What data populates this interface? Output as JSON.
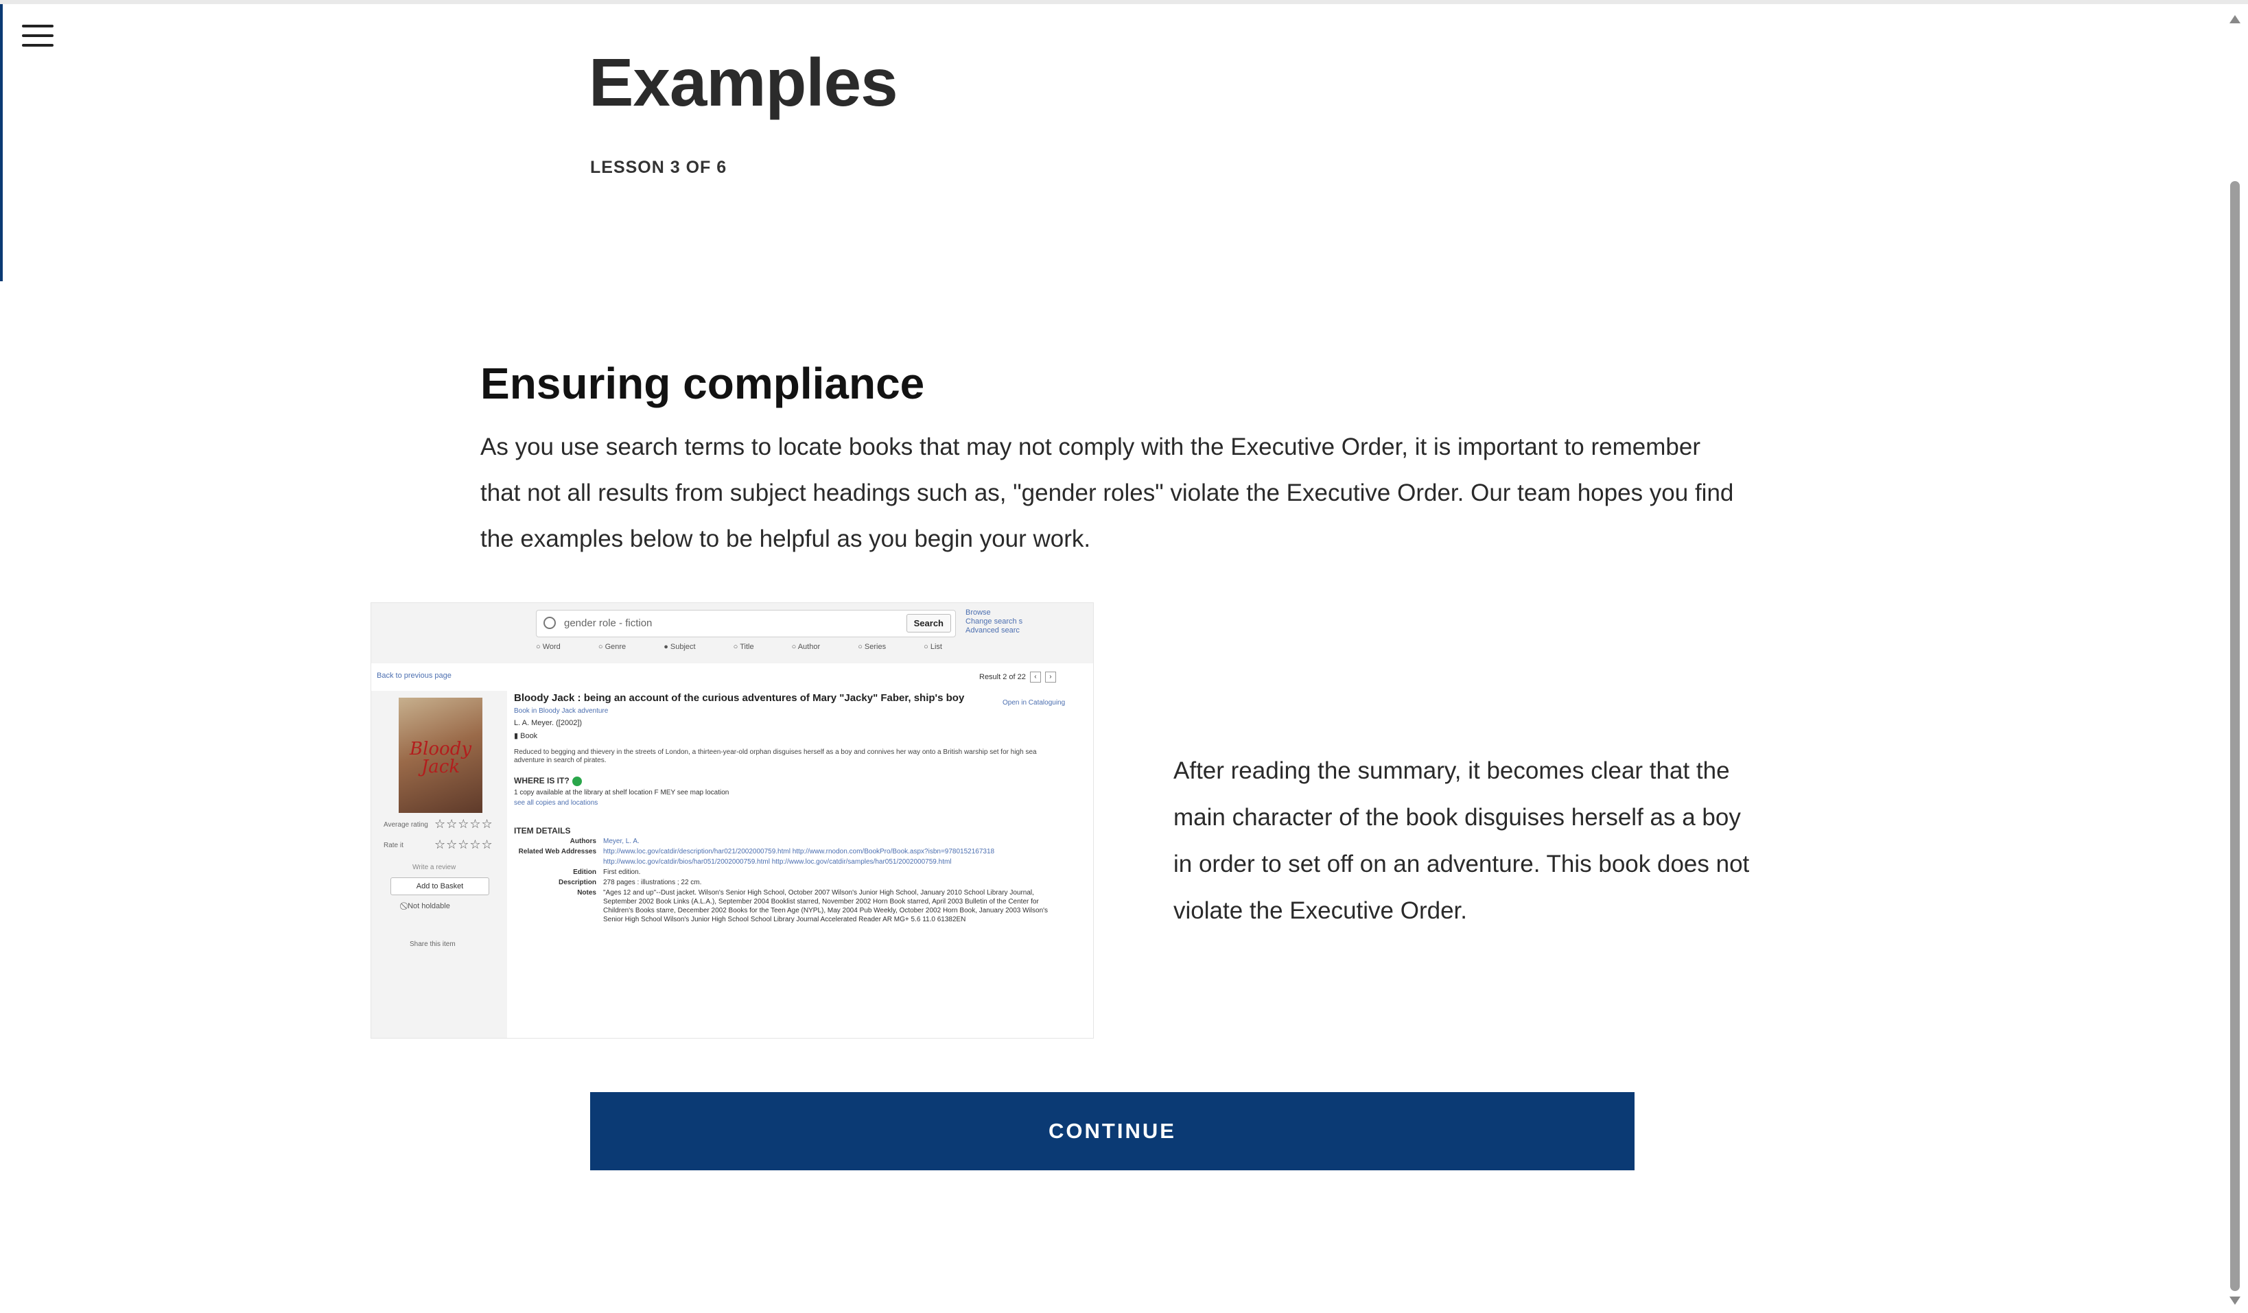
{
  "header": {
    "title": "Examples",
    "counter": "LESSON 3 OF 6"
  },
  "section": {
    "heading": "Ensuring compliance",
    "intro": "As you use search terms to locate books that may not comply with the Executive Order, it is important to remember that not all results from subject headings such as, \"gender roles\" violate the Executive Order.  Our team hopes you find the examples below to be helpful as you begin your work."
  },
  "catalog": {
    "search_value": "gender role - fiction",
    "search_button": "Search",
    "links": [
      "Browse",
      "Change search s",
      "Advanced searc"
    ],
    "radios": [
      "Word",
      "Genre",
      "Subject",
      "Title",
      "Author",
      "Series",
      "List"
    ],
    "back": "Back to previous page",
    "result": "Result 2 of 22",
    "cover_text": "Bloody Jack",
    "avg_label": "Average rating",
    "rate_label": "Rate it",
    "stars": "☆☆☆☆☆",
    "write_review": "Write a review",
    "add_basket": "Add to Basket",
    "not_holdable": "Not holdable",
    "share": "Share this item",
    "book_title": "Bloody Jack : being an account of the curious adventures of Mary \"Jacky\" Faber, ship's boy",
    "series": "Book in Bloody Jack adventure",
    "author_line": "L. A. Meyer. ([2002])",
    "format": "Book",
    "open_in": "Open in Cataloguing",
    "summary": "Reduced to begging and thievery in the streets of London, a thirteen-year-old orphan disguises herself as a boy and connives her way onto a British warship set for high sea adventure in search of pirates.",
    "where": "WHERE IS IT?",
    "availability": "1 copy available at the library at shelf location F MEY see map location",
    "all_copies": "see all copies and locations",
    "item_details": "ITEM DETAILS",
    "details": [
      {
        "k": "Authors",
        "v": "Meyer, L. A."
      },
      {
        "k": "Related Web Addresses",
        "v": "http://www.loc.gov/catdir/description/har021/2002000759.html  http://www.rnodon.com/BookPro/Book.aspx?isbn=9780152167318"
      },
      {
        "k": "",
        "v": "http://www.loc.gov/catdir/bios/har051/2002000759.html  http://www.loc.gov/catdir/samples/har051/2002000759.html"
      },
      {
        "k": "Edition",
        "v": "First edition."
      },
      {
        "k": "Description",
        "v": "278 pages : illustrations ; 22 cm."
      },
      {
        "k": "Notes",
        "v": "\"Ages 12 and up\"--Dust jacket. Wilson's Senior High School, October 2007 Wilson's Junior High School, January 2010 School Library Journal, September 2002 Book Links (A.L.A.), September 2004 Booklist starred, November 2002 Horn Book starred, April 2003 Bulletin of the Center for Children's Books starre, December 2002 Books for the Teen Age (NYPL), May 2004 Pub Weekly, October 2002 Horn Book, January 2003 Wilson's Senior High School Wilson's Junior High School School Library Journal Accelerated Reader AR MG+ 5.6 11.0 61382EN"
      }
    ]
  },
  "aside": {
    "text": "After reading the summary, it becomes clear that the main character of the book disguises herself as a boy in order to set off on an adventure.  This book does not violate the Executive Order."
  },
  "footer": {
    "continue_label": "CONTINUE"
  },
  "icons": {
    "menu": "hamburger-icon",
    "search": "search-icon"
  },
  "colors": {
    "primary": "#0b3a74"
  }
}
